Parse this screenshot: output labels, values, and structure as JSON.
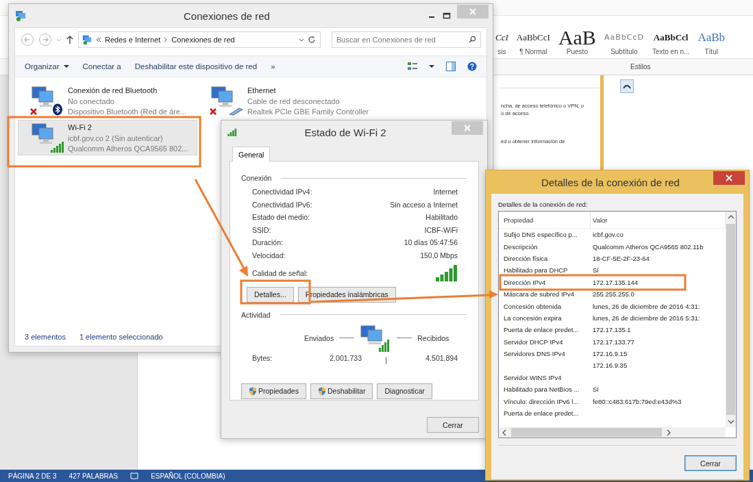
{
  "word": {
    "styles": [
      {
        "sample": "CcI",
        "label": "sis",
        "kind": "emphasis"
      },
      {
        "sample": "AaBbCcI",
        "label": "¶ Normal",
        "kind": "normal"
      },
      {
        "sample": "AaB",
        "label": "Puesto",
        "kind": "title"
      },
      {
        "sample": "AaBbCcD",
        "label": "Subtítulo",
        "kind": "subtitle"
      },
      {
        "sample": "AaBbCcl",
        "label": "Texto en n...",
        "kind": "strong"
      },
      {
        "sample": "AaBb",
        "label": "Títul",
        "kind": "heading"
      }
    ],
    "group_label": "Estilos",
    "fragments": [
      "ncha, de acceso telefónico o VPN; o",
      "o de acceso.",
      "ed u obtener información de"
    ],
    "status_bar": {
      "page": "PÁGINA 2 DE 3",
      "words": "427 PALABRAS",
      "language": "ESPAÑOL (COLOMBIA)"
    }
  },
  "network_window": {
    "title": "Conexiones de red",
    "active": false,
    "breadcrumb": [
      "Redes e Internet",
      "Conexiones de red"
    ],
    "search": {
      "placeholder": "Buscar en Conexiones de red"
    },
    "toolbar": [
      {
        "label": "Organizar",
        "dropdown": true
      },
      {
        "label": "Conectar a",
        "dropdown": false
      },
      {
        "label": "Deshabilitar este dispositivo de red",
        "dropdown": false
      }
    ],
    "more": "»",
    "items": [
      {
        "kind": "bluetooth",
        "name": "Conexión de red Bluetooth",
        "status": "No conectado",
        "device": "Dispositivo Bluetooth (Red de áre...",
        "connected": false,
        "selected": false
      },
      {
        "kind": "ethernet",
        "name": "Ethernet",
        "status": "Cable de red desconectado",
        "device": "Realtek PCIe GBE Family Controller",
        "connected": false,
        "selected": false
      },
      {
        "kind": "wifi",
        "name": "Wi-Fi 2",
        "status": "icbf.gov.co 2 (Sin autenticar)",
        "device": "Qualcomm Atheros QCA9565 802...",
        "connected": true,
        "selected": true
      }
    ],
    "footer": [
      "3 elementos",
      "1 elemento seleccionado"
    ]
  },
  "status_window": {
    "title": "Estado de Wi-Fi 2",
    "active": false,
    "tabs": [
      {
        "label": "General",
        "selected": true
      }
    ],
    "connection": {
      "heading": "Conexión",
      "rows": [
        {
          "label": "Conectividad IPv4:",
          "value": "Internet"
        },
        {
          "label": "Conectividad IPv6:",
          "value": "Sin acceso a Internet"
        },
        {
          "label": "Estado del medio:",
          "value": "Habilitado"
        },
        {
          "label": "SSID:",
          "value": "ICBF-WiFi"
        },
        {
          "label": "Duración:",
          "value": "10 días 05:47:56"
        },
        {
          "label": "Velocidad:",
          "value": "150,0 Mbps"
        }
      ],
      "signal_label": "Calidad de señal:"
    },
    "actions": [
      "Detalles...",
      "Propiedades inalámbricas"
    ],
    "activity": {
      "heading": "Actividad",
      "sent": "Enviados",
      "received": "Recibidos",
      "bytes_label": "Bytes:",
      "bytes_sent": "2.001.733",
      "bytes_received": "4.501.894"
    },
    "buttons": [
      {
        "label": "Propiedades",
        "shield": true
      },
      {
        "label": "Deshabilitar",
        "shield": true
      },
      {
        "label": "Diagnosticar",
        "shield": false
      }
    ],
    "close": "Cerrar"
  },
  "details_window": {
    "title": "Detalles de la conexión de red",
    "active": true,
    "caption": "Detalles de la conexión de red:",
    "columns": [
      "Propiedad",
      "Valor"
    ],
    "rows": [
      {
        "property": "Sufijo DNS específico p...",
        "value": "icbf.gov.co"
      },
      {
        "property": "Descripción",
        "value": "Qualcomm Atheros QCA9565 802.11b"
      },
      {
        "property": "Dirección física",
        "value": "18-CF-5E-2F-23-64"
      },
      {
        "property": "Habilitado para DHCP",
        "value": "Sí"
      },
      {
        "property": "Dirección IPv4",
        "value": "172.17.135.144"
      },
      {
        "property": "Máscara de subred IPv4",
        "value": "255.255.255.0"
      },
      {
        "property": "Concesión obtenida",
        "value": "lunes, 26 de diciembre de 2016 4:31:"
      },
      {
        "property": "La concesión expira",
        "value": "lunes, 26 de diciembre de 2016 5:31:"
      },
      {
        "property": "Puerta de enlace predet...",
        "value": "172.17.135.1"
      },
      {
        "property": "Servidor DHCP IPv4",
        "value": "172.17.133.77"
      },
      {
        "property": "Servidores DNS IPv4",
        "value": "172.16.9.15"
      },
      {
        "value": "172.16.9.35"
      },
      {
        "property": "Servidor WINS IPv4"
      },
      {
        "property": "Habilitado para NetBios ...",
        "value": "Sí"
      },
      {
        "property": "Vínculo: dirección IPv6 l...",
        "value": "fe80::c483:617b:79ed:e43d%3"
      },
      {
        "property": "Puerta de enlace predet..."
      }
    ],
    "close": "Cerrar"
  }
}
